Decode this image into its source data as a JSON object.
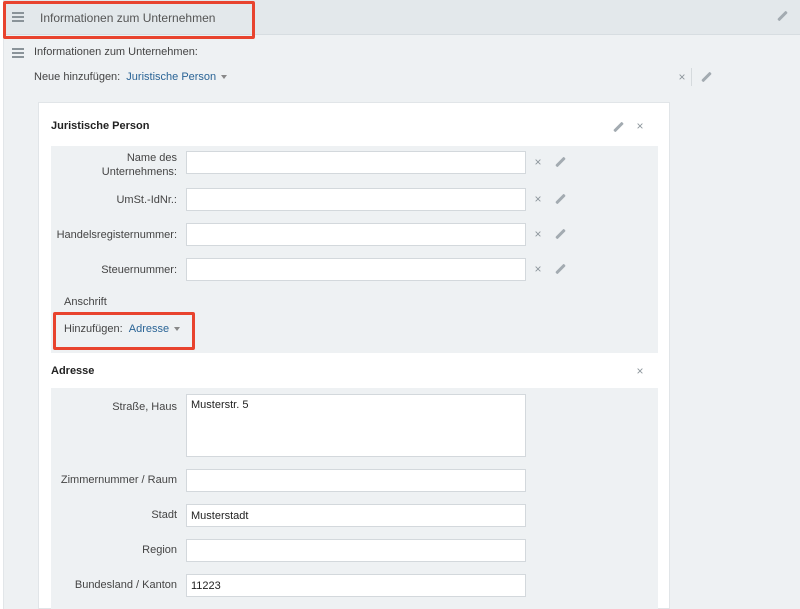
{
  "header": {
    "title": "Informationen zum Unternehmen"
  },
  "section": {
    "title": "Informationen zum Unternehmen:"
  },
  "add_new": {
    "label": "Neue hinzufügen:",
    "selected": "Juristische Person"
  },
  "person_card": {
    "title": "Juristische Person",
    "fields": [
      {
        "label": "Name des Unternehmens:",
        "value": ""
      },
      {
        "label": "UmSt.-IdNr.:",
        "value": ""
      },
      {
        "label": "Handelsregisternummer:",
        "value": ""
      },
      {
        "label": "Steuernummer:",
        "value": ""
      }
    ],
    "anschrift_label": "Anschrift",
    "add_label": "Hinzufügen:",
    "add_selected": "Adresse"
  },
  "address_card": {
    "title": "Adresse",
    "fields": [
      {
        "label": "Straße, Haus",
        "value": "Musterstr. 5"
      },
      {
        "label": "Zimmernummer / Raum",
        "value": ""
      },
      {
        "label": "Stadt",
        "value": "Musterstadt"
      },
      {
        "label": "Region",
        "value": ""
      },
      {
        "label": "Bundesland / Kanton",
        "value": "11223"
      }
    ]
  },
  "colors": {
    "highlight": "#e8432e",
    "link": "#2a6496",
    "panel": "#eef1f3"
  },
  "icons": [
    "menu-icon",
    "pencil-icon",
    "close-icon",
    "caret-down-icon"
  ]
}
